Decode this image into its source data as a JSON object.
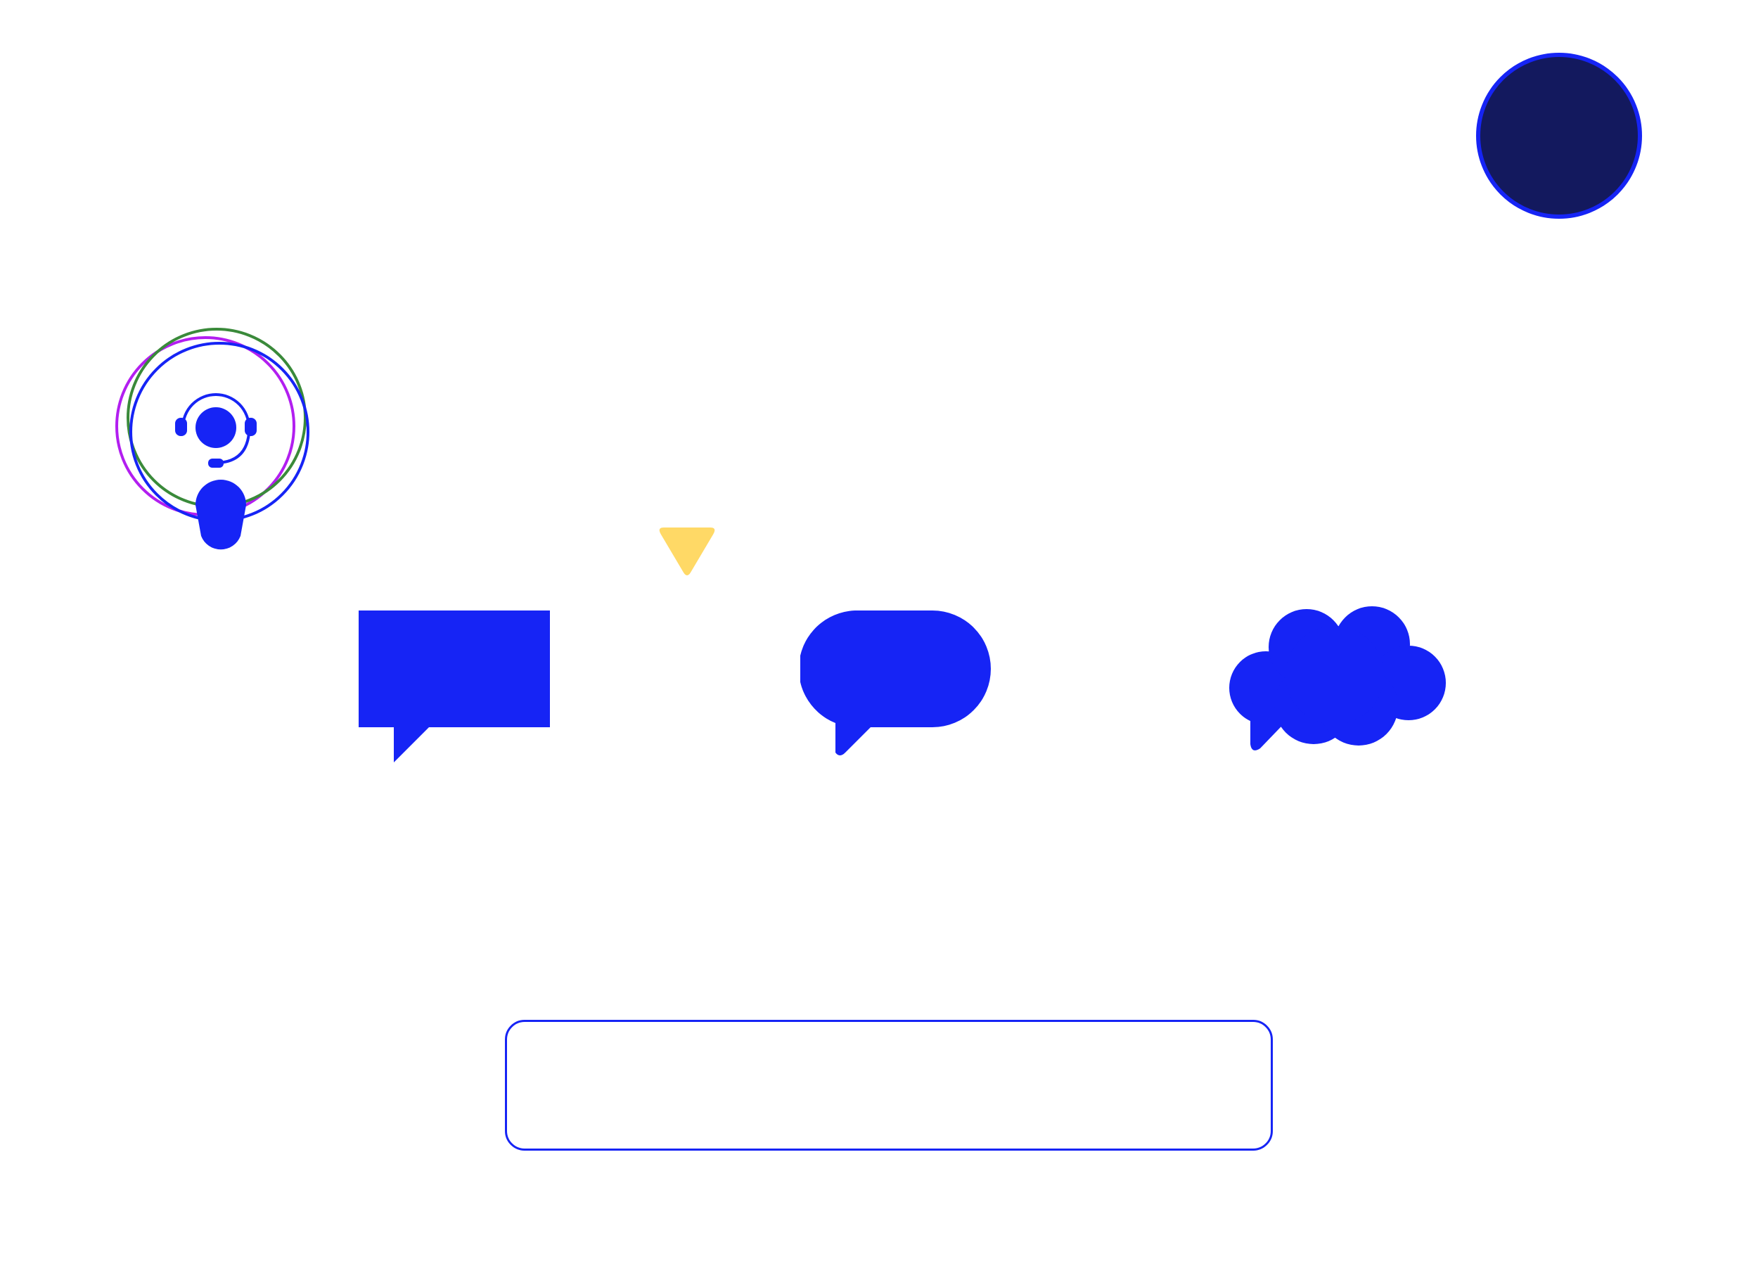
{
  "colors": {
    "accent": "#1624f5",
    "avatar_fill": "#13195e",
    "ring_purple": "#b21ef0",
    "ring_green": "#3a8a3a",
    "pointer_yellow": "#ffd966",
    "background": "#ffffff"
  },
  "icons": {
    "avatar": "avatar-circle",
    "support": "headset-agent-icon",
    "pointer": "triangle-down-icon",
    "bubble_square": "speech-bubble-square-icon",
    "bubble_rounded": "speech-bubble-rounded-icon",
    "bubble_cloud": "thought-bubble-cloud-icon"
  },
  "chat_input": {
    "value": "",
    "placeholder": ""
  }
}
